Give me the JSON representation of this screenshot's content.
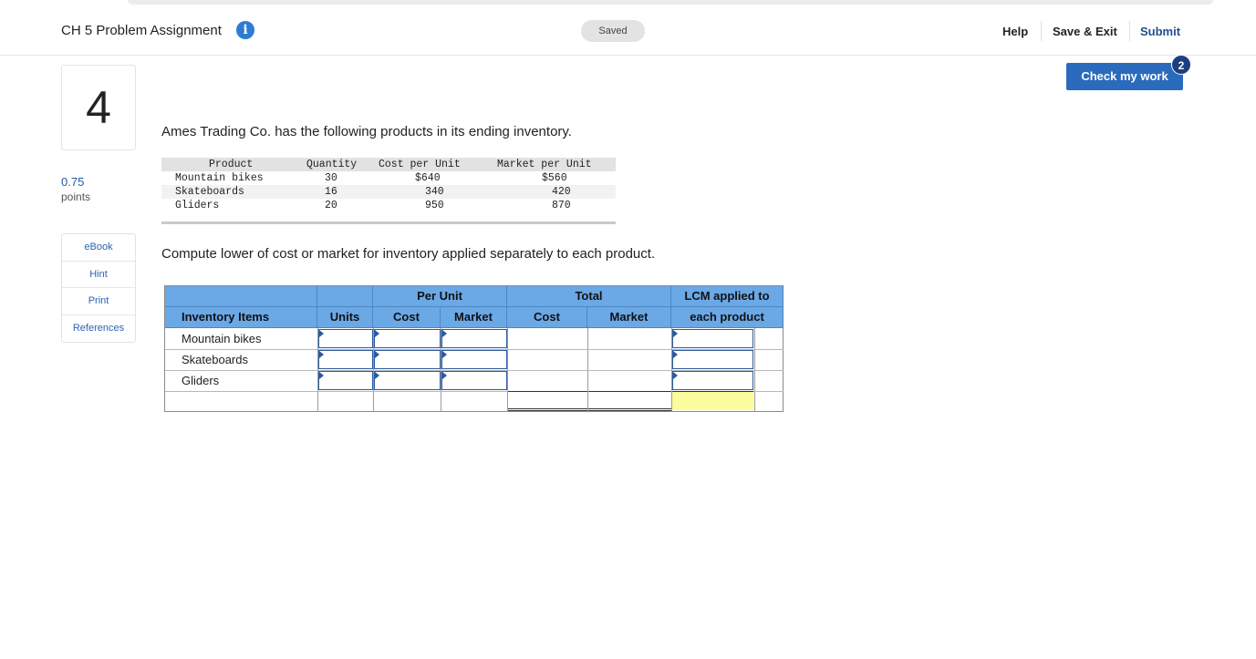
{
  "header": {
    "title": "CH 5 Problem Assignment",
    "saved": "Saved",
    "help": "Help",
    "save_exit": "Save & Exit",
    "submit": "Submit"
  },
  "question": {
    "number": "4",
    "points_value": "0.75",
    "points_label": "points"
  },
  "sidenav": [
    "eBook",
    "Hint",
    "Print",
    "References"
  ],
  "check": {
    "label": "Check my work",
    "badge": "2"
  },
  "intro": "Ames Trading Co. has the following products in its ending inventory.",
  "product_table": {
    "headers": [
      "Product",
      "Quantity",
      "Cost per Unit",
      "Market per Unit"
    ],
    "rows": [
      [
        "Mountain bikes",
        "30",
        "$640",
        "$560"
      ],
      [
        "Skateboards",
        "16",
        "340",
        "420"
      ],
      [
        "Gliders",
        "20",
        "950",
        "870"
      ]
    ]
  },
  "instruction": "Compute lower of cost or market for inventory applied separately to each product.",
  "worksheet": {
    "group_per_unit": "Per Unit",
    "group_total": "Total",
    "lcm_line1": "LCM applied to",
    "lcm_line2": "each product",
    "col_items": "Inventory Items",
    "col_units": "Units",
    "col_cost": "Cost",
    "col_market": "Market",
    "col_total_cost": "Cost",
    "col_total_market": "Market",
    "rows": [
      "Mountain bikes",
      "Skateboards",
      "Gliders"
    ]
  },
  "colors": {
    "accent": "#2b6bbd",
    "header_fill": "#6ba8e6",
    "highlight": "#fbfc9c"
  }
}
